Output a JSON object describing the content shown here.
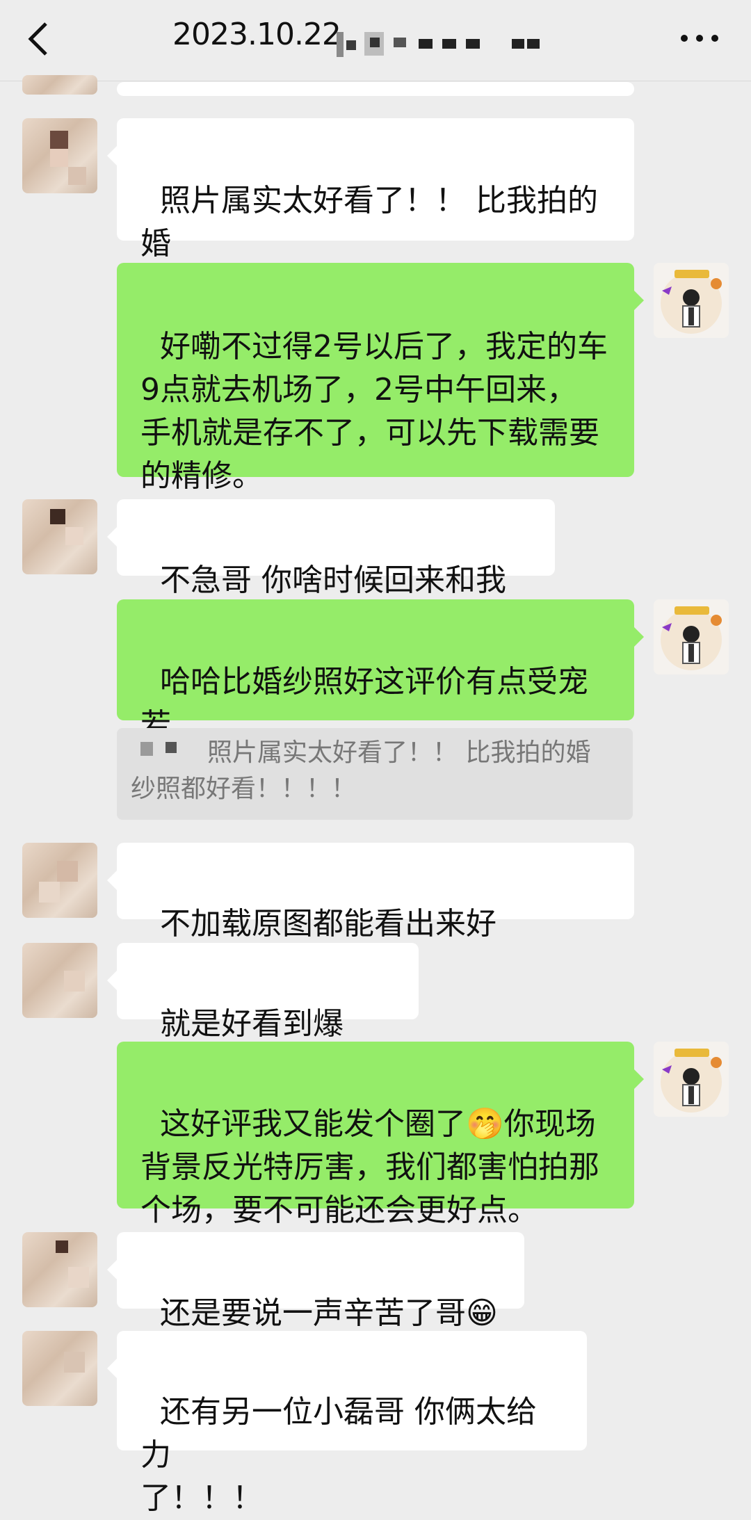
{
  "header": {
    "title": "2023.10.22",
    "back_icon": "chevron-left-icon",
    "more_icon": "more-horizontal-icon"
  },
  "messages": [
    {
      "side": "left",
      "text": "照片属实太好看了！！ 比我拍的婚\n纱照都好看！！！！"
    },
    {
      "side": "right",
      "text": "好嘞不过得2号以后了，我定的车\n9点就去机场了，2号中午回来，\n手机就是存不了，可以先下载需要\n的精修。"
    },
    {
      "side": "left",
      "text": "不急哥 你啥时候回来和我说"
    },
    {
      "side": "right",
      "text": "哈哈比婚纱照好这评价有点受宠若\n惊了"
    },
    {
      "side": "left",
      "text": "不加载原图都能看出来好看！！！"
    },
    {
      "side": "left",
      "text": "就是好看到爆了！"
    },
    {
      "side": "right",
      "text": "这好评我又能发个圈了🤭你现场\n背景反光特厉害，我们都害怕拍那\n个场，要不可能还会更好点。"
    },
    {
      "side": "left",
      "text": "还是要说一声辛苦了哥😁"
    },
    {
      "side": "left",
      "text": "还有另一位小磊哥 你俩太给力\n了！！！"
    }
  ],
  "quote": {
    "text": "照片属实太好看了！！ 比我拍的婚\n纱照都好看！！！！"
  },
  "colors": {
    "background": "#ededed",
    "bubble_self": "#95ec69",
    "bubble_other": "#ffffff"
  }
}
